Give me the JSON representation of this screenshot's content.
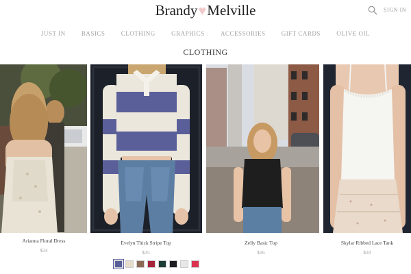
{
  "header": {
    "brand_left": "Brandy",
    "brand_right": "Melville",
    "sign_in": "SIGN IN"
  },
  "nav": {
    "items": [
      "JUST IN",
      "BASICS",
      "CLOTHING",
      "GRAPHICS",
      "ACCESSORIES",
      "GIFT CARDS",
      "OLIVE OIL"
    ]
  },
  "page": {
    "section_title": "CLOTHING"
  },
  "products": [
    {
      "name": "Arianna Floral Dress",
      "price": "$34"
    },
    {
      "name": "Evelyn Thick Stripe Top",
      "price": "$35"
    },
    {
      "name": "Zelly Basic Top",
      "price": "$16"
    },
    {
      "name": "Skylar Ribbed Lace Tank",
      "price": "$18"
    }
  ],
  "swatches": {
    "colors": [
      "#5a5f9a",
      "#e6dccb",
      "#8a6a55",
      "#a5233b",
      "#1e3d36",
      "#1d1d24",
      "#e7e7e7",
      "#d93452"
    ]
  },
  "colors": {
    "text": "#333333",
    "muted": "#a3a3a3",
    "accent_heart": "#f2c9c9"
  }
}
